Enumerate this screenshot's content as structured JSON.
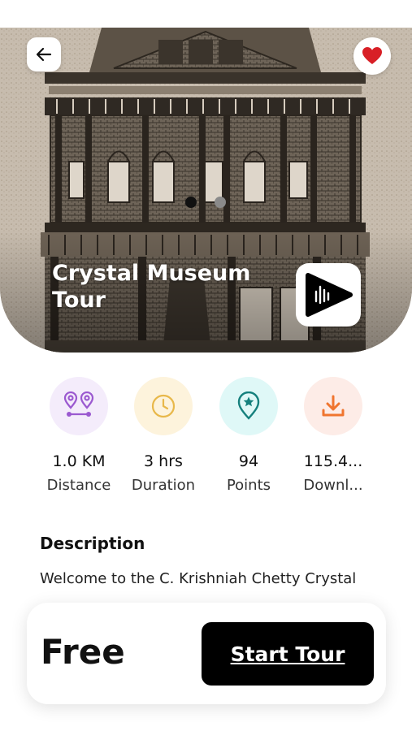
{
  "hero": {
    "title": "Crystal Museum Tour",
    "slide_count": 2,
    "active_slide": 1
  },
  "stats": [
    {
      "value": "1.0 KM",
      "label": "Distance",
      "icon": "route-pins-icon",
      "bg": "#f4ecfb",
      "color": "#9b59d0"
    },
    {
      "value": "3 hrs",
      "label": "Duration",
      "icon": "clock-icon",
      "bg": "#fdf3dc",
      "color": "#e8b84a"
    },
    {
      "value": "94",
      "label": "Points",
      "icon": "star-pin-icon",
      "bg": "#dff8f7",
      "color": "#15807d"
    },
    {
      "value": "115.4...",
      "label": "Downl...",
      "icon": "download-icon",
      "bg": "#fdece7",
      "color": "#f0752f"
    }
  ],
  "description": {
    "title": "Description",
    "text": "Welcome to the C. Krishniah Chetty Crystal"
  },
  "footer": {
    "price": "Free",
    "cta": "Start Tour"
  },
  "colors": {
    "favorite": "#d81f26",
    "cta_bg": "#000000"
  }
}
